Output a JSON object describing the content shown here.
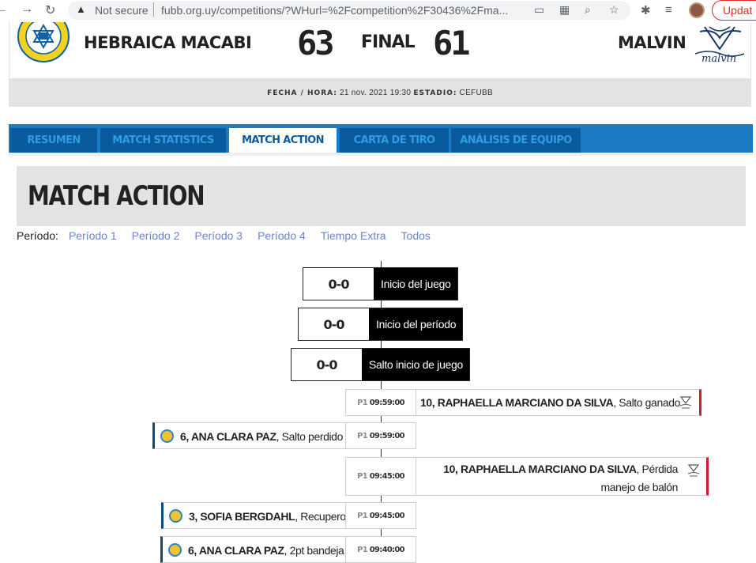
{
  "browser": {
    "security_label": "Not secure",
    "url": "fubb.org.uy/competitions/?WHurl=%2Fcompetition%2F30436%2Fma...",
    "update_label": "Updat"
  },
  "match": {
    "home_team": "HEBRAICA MACABI",
    "home_score": "63",
    "status": "FINAL",
    "away_score": "61",
    "away_team": "MALVIN",
    "away_logo_text": "malvin",
    "date_label": "FECHA / HORA:",
    "date_value": "21 nov. 2021 19:30",
    "venue_label": "ESTADIO:",
    "venue_value": "CEFUBB"
  },
  "tabs": [
    {
      "label": "RESUMEN"
    },
    {
      "label": "MATCH STATISTICS"
    },
    {
      "label": "MATCH ACTION"
    },
    {
      "label": "CARTA DE TIRO"
    },
    {
      "label": "ANÁLISIS DE EQUIPO"
    }
  ],
  "section": {
    "title": "MATCH ACTION",
    "period_label": "Período:",
    "periods": [
      "Período 1",
      "Período 2",
      "Período 3",
      "Período 4",
      "Tiempo Extra",
      "Todos"
    ]
  },
  "timeline": {
    "center_events": [
      {
        "score": "0-0",
        "event": "Inicio del juego"
      },
      {
        "score": "0-0",
        "event": "Inicio del período"
      },
      {
        "score": "0-0",
        "event": "Salto inicio de juego"
      }
    ],
    "events": [
      {
        "side": "away",
        "period": "P1",
        "time": "09:59:00",
        "player": "10, RAPHAELLA MARCIANO DA SILVA",
        "action": "Salto ganado"
      },
      {
        "side": "home",
        "period": "P1",
        "time": "09:59:00",
        "player": "6, ANA CLARA PAZ",
        "action": "Salto perdido"
      },
      {
        "side": "away",
        "period": "P1",
        "time": "09:45:00",
        "player": "10, RAPHAELLA MARCIANO DA SILVA",
        "action_line1": "Pérdida",
        "action_line2": "manejo de balón"
      },
      {
        "side": "home",
        "period": "P1",
        "time": "09:45:00",
        "player": "3, SOFIA BERGDAHL",
        "action": "Recupero"
      },
      {
        "side": "home",
        "period": "P1",
        "time": "09:40:00",
        "player": "6, ANA CLARA PAZ",
        "action": "2pt bandeja"
      }
    ]
  },
  "colors": {
    "tab_bar": "#1a7bc4",
    "tab_inactive": "#0a5b9d",
    "home_accent": "#0a4a7a",
    "away_accent": "#d21b2a",
    "period_link": "#6f84c9"
  },
  "icons": {
    "home_event_icon": "basketball-icon",
    "away_event_icon": "malvin-crest-icon"
  }
}
